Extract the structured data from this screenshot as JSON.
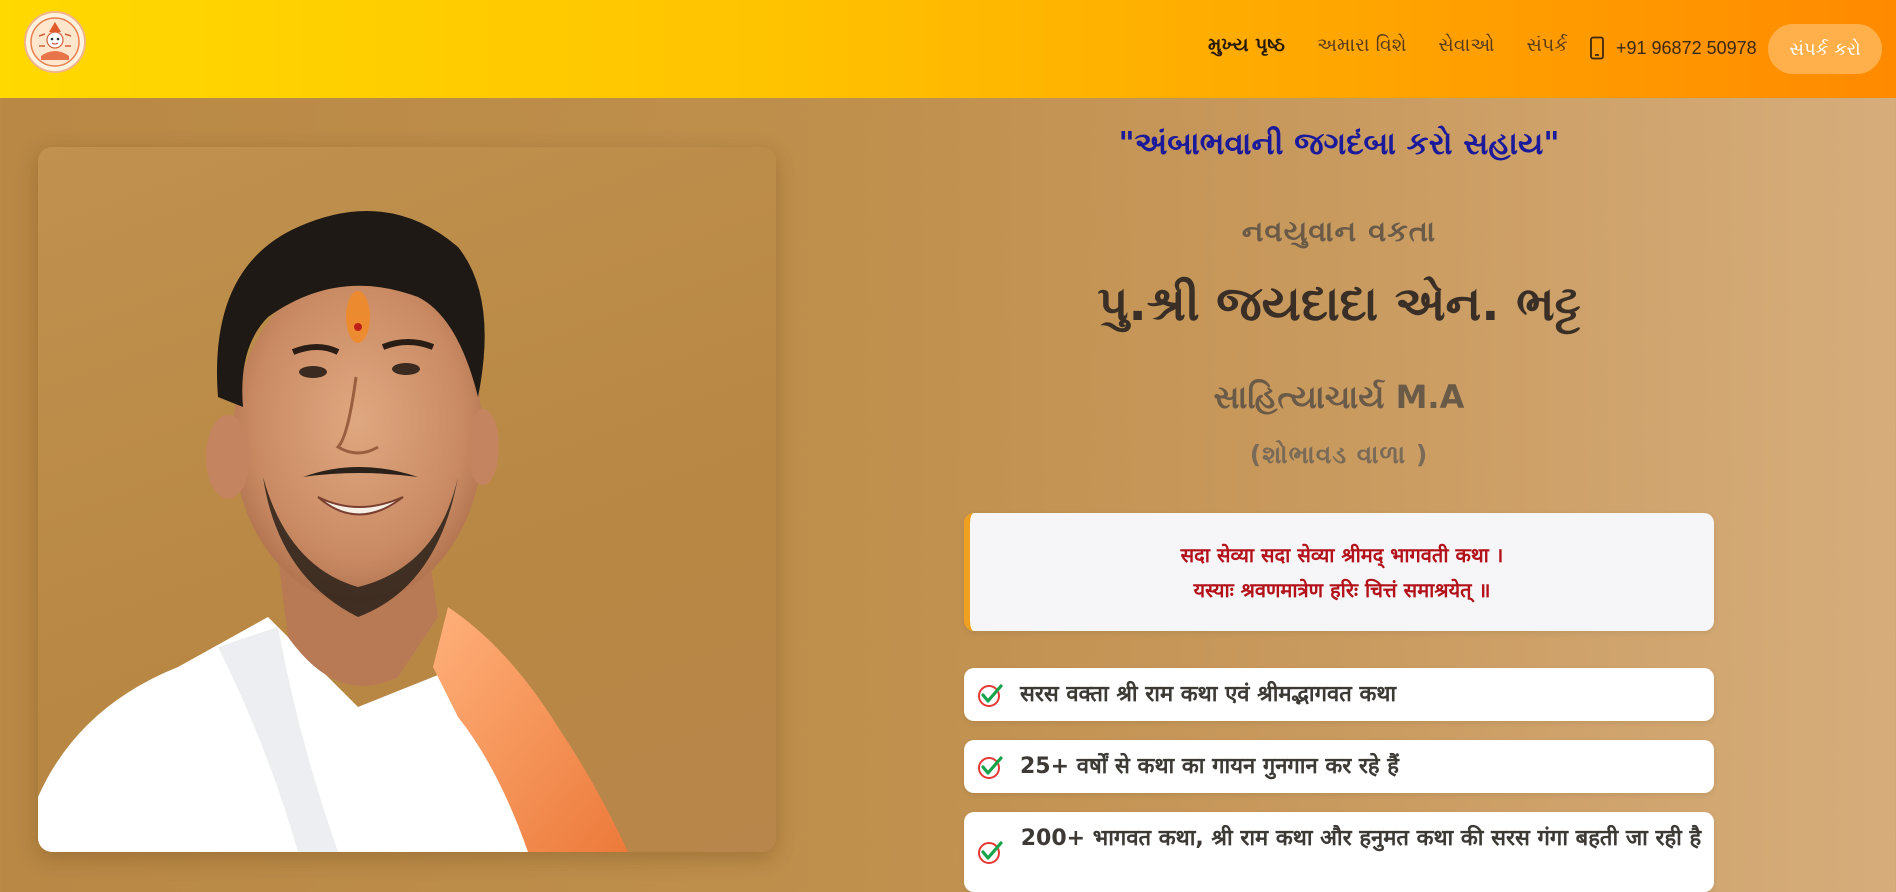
{
  "header": {
    "nav": [
      {
        "label": "મુખ્ય પૃષ્ઠ",
        "active": true
      },
      {
        "label": "અમારા વિશે",
        "active": false
      },
      {
        "label": "સેવાઓ",
        "active": false
      },
      {
        "label": "સંપર્ક",
        "active": false
      }
    ],
    "phone": "+91 96872 50978",
    "cta_label": "સંપર્ક કરો",
    "colors": {
      "gradient_start": "#ffd900",
      "gradient_end": "#ff8a00"
    }
  },
  "hero": {
    "quote": "\"અંબાભવાની જગદંબા કરો સહાય\"",
    "subtitle": "નવયુવાન વકતા",
    "name": "પુ.શ્રી જયદાદા એન. ભટ્ટ",
    "degree": "સાહિત્યાચાર્ય M.A",
    "place": "(શોભાવડ વાળા )",
    "verse": {
      "line1": "सदा सेव्या सदा सेव्या श्रीमद् भागवती कथा ।",
      "line2": "यस्याः श्रवणमात्रेण हरिः चित्तं समाश्रयेत् ॥"
    },
    "features": [
      "सरस वक्ता श्री राम कथा एवं श्रीमद्भागवत कथा",
      "25+ वर्षों से कथा का गायन गुनगान कर रहे हैं",
      "200+ भागवत कथा, श्री राम कथा और हनुमत कथा की सरस गंगा बहती जा रही है"
    ],
    "icons": {
      "check": "check-circle-icon",
      "phone": "mobile-phone-icon",
      "logo": "deity-logo"
    }
  }
}
